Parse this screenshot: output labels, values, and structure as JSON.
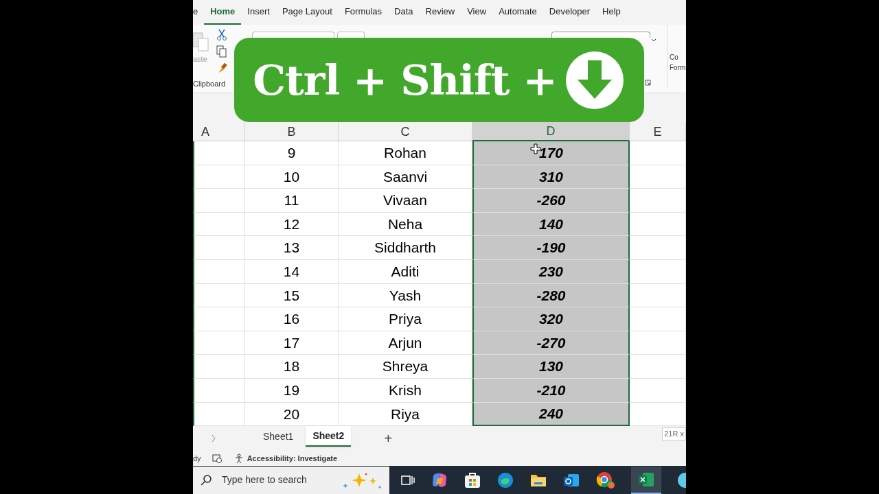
{
  "ribbon_tabs": [
    {
      "label": "e",
      "selected": false
    },
    {
      "label": "Home",
      "selected": true
    },
    {
      "label": "Insert",
      "selected": false
    },
    {
      "label": "Page Layout",
      "selected": false
    },
    {
      "label": "Formulas",
      "selected": false
    },
    {
      "label": "Data",
      "selected": false
    },
    {
      "label": "Review",
      "selected": false
    },
    {
      "label": "View",
      "selected": false
    },
    {
      "label": "Automate",
      "selected": false
    },
    {
      "label": "Developer",
      "selected": false
    },
    {
      "label": "Help",
      "selected": false
    }
  ],
  "ribbon": {
    "paste_label": "aste",
    "clipboard_label": "Clipboard",
    "cut_label_1": "Co",
    "cut_label_2": "Form"
  },
  "overlay_banner": {
    "text": "Ctrl + Shift +"
  },
  "columns": [
    {
      "label": "A",
      "selected": false
    },
    {
      "label": "B",
      "selected": false
    },
    {
      "label": "C",
      "selected": false
    },
    {
      "label": "D",
      "selected": true
    },
    {
      "label": "E",
      "selected": false
    }
  ],
  "rows": [
    {
      "b": "9",
      "c": "Rohan",
      "d": "170"
    },
    {
      "b": "10",
      "c": "Saanvi",
      "d": "310"
    },
    {
      "b": "11",
      "c": "Vivaan",
      "d": "-260"
    },
    {
      "b": "12",
      "c": "Neha",
      "d": "140"
    },
    {
      "b": "13",
      "c": "Siddharth",
      "d": "-190"
    },
    {
      "b": "14",
      "c": "Aditi",
      "d": "230"
    },
    {
      "b": "15",
      "c": "Yash",
      "d": "-280"
    },
    {
      "b": "16",
      "c": "Priya",
      "d": "320"
    },
    {
      "b": "17",
      "c": "Arjun",
      "d": "-270"
    },
    {
      "b": "18",
      "c": "Shreya",
      "d": "130"
    },
    {
      "b": "19",
      "c": "Krish",
      "d": "-210"
    },
    {
      "b": "20",
      "c": "Riya",
      "d": "240"
    }
  ],
  "sheet_tabs": [
    {
      "label": "Sheet1",
      "selected": false
    },
    {
      "label": "Sheet2",
      "selected": true
    }
  ],
  "add_sheet": "+",
  "selection_size": "21R x",
  "status_bar": {
    "mode": "dy",
    "accessibility": "Accessibility: Investigate"
  },
  "taskbar": {
    "search_placeholder": "Type here to search"
  }
}
